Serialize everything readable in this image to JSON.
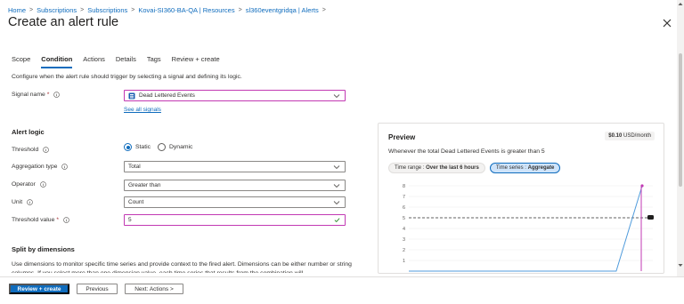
{
  "breadcrumb": [
    "Home",
    "Subscriptions",
    "Subscriptions",
    "Kovai-SI360-BA-QA | Resources",
    "sl360eventgridqa | Alerts"
  ],
  "title": "Create an alert rule",
  "tabs": [
    "Scope",
    "Condition",
    "Actions",
    "Details",
    "Tags",
    "Review + create"
  ],
  "active_tab": "Condition",
  "intro": "Configure when the alert rule should trigger by selecting a signal and defining its logic.",
  "signal": {
    "label": "Signal name",
    "value": "Dead Lettered Events",
    "see_all": "See all signals"
  },
  "alert_logic": {
    "heading": "Alert logic",
    "threshold_label": "Threshold",
    "threshold_options": [
      "Static",
      "Dynamic"
    ],
    "threshold_selected": "Static",
    "aggregation_label": "Aggregation type",
    "aggregation_value": "Total",
    "operator_label": "Operator",
    "operator_value": "Greater than",
    "unit_label": "Unit",
    "unit_value": "Count",
    "threshold_value_label": "Threshold value",
    "threshold_value": "5"
  },
  "split": {
    "heading": "Split by dimensions",
    "text": "Use dimensions to monitor specific time series and provide context to the fired alert. Dimensions can be either number or string columns. If you select more than one dimension value, each time series that results from the combination will"
  },
  "preview": {
    "title": "Preview",
    "price": "$0.10",
    "price_unit": "USD/month",
    "description": "Whenever the total Dead Lettered Events is greater than 5",
    "time_range_label": "Time range :",
    "time_range_value": "Over the last 6 hours",
    "time_series_label": "Time series :",
    "time_series_value": "Aggregate"
  },
  "chart_data": {
    "type": "line",
    "y_ticks": [
      "8",
      "7",
      "6",
      "5",
      "4",
      "3",
      "2",
      "1"
    ],
    "ylim": [
      0,
      8
    ],
    "threshold": 5,
    "series": [
      {
        "values": [
          0,
          0,
          0,
          0,
          0,
          0,
          0,
          0,
          0,
          8
        ]
      }
    ],
    "grid": true
  },
  "footer": {
    "review": "Review + create",
    "previous": "Previous",
    "next": "Next: Actions >"
  },
  "colors": {
    "accent": "#0f6cbd",
    "focus": "#c239b3",
    "required": "#a4262c",
    "series": "#c239b3",
    "series2": "#4f9bdc"
  }
}
